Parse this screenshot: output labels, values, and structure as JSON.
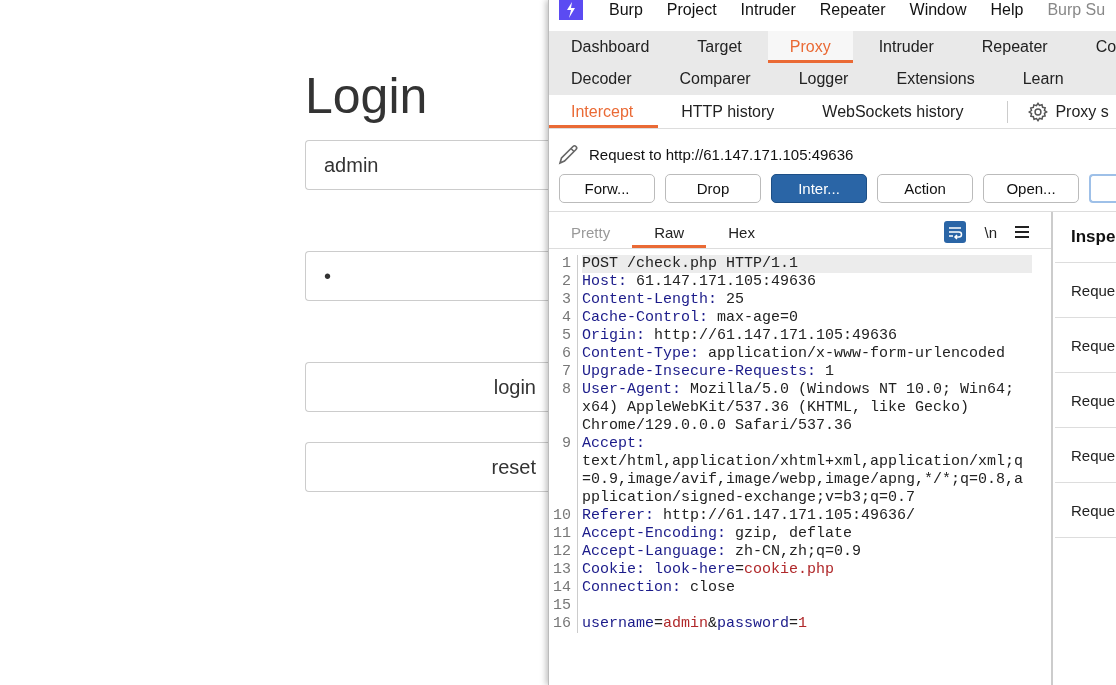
{
  "login_page": {
    "title": "Login",
    "username": {
      "value": "admin"
    },
    "password": {
      "value": "•"
    },
    "buttons": [
      "login",
      "reset"
    ]
  },
  "menu_bar": {
    "items": [
      "Burp",
      "Project",
      "Intruder",
      "Repeater",
      "Window",
      "Help"
    ],
    "app_title": "Burp Su"
  },
  "tool_tabs": [
    [
      {
        "label": "Dashboard",
        "selected": false
      },
      {
        "label": "Target",
        "selected": false
      },
      {
        "label": "Proxy",
        "selected": true
      },
      {
        "label": "Intruder",
        "selected": false
      },
      {
        "label": "Repeater",
        "selected": false
      },
      {
        "label": "Co",
        "selected": false
      }
    ],
    [
      {
        "label": "Decoder",
        "selected": false
      },
      {
        "label": "Comparer",
        "selected": false
      },
      {
        "label": "Logger",
        "selected": false
      },
      {
        "label": "Extensions",
        "selected": false
      },
      {
        "label": "Learn",
        "selected": false
      }
    ]
  ],
  "proxy_tabs": [
    {
      "label": "Intercept",
      "selected": true
    },
    {
      "label": "HTTP history",
      "selected": false
    },
    {
      "label": "WebSockets history",
      "selected": false
    }
  ],
  "proxy_settings": "Proxy s",
  "request_title": "Request to http://61.147.171.105:49636",
  "actions": [
    {
      "label": "Forw...",
      "on": false
    },
    {
      "label": "Drop",
      "on": false
    },
    {
      "label": "Inter...",
      "on": true
    },
    {
      "label": "Action",
      "on": false
    },
    {
      "label": "Open...",
      "on": false
    }
  ],
  "editor": {
    "tabs": [
      {
        "label": "Pretty",
        "selected": false,
        "disabled": true
      },
      {
        "label": "Raw",
        "selected": true,
        "disabled": false
      },
      {
        "label": "Hex",
        "selected": false,
        "disabled": false
      }
    ],
    "wrap_on": true,
    "newline_label": "\\n",
    "lines": [
      {
        "number": "1",
        "highlighted": true,
        "parts": [
          {
            "kind": "plain",
            "text": "POST /check.php HTTP/1.1"
          }
        ]
      },
      {
        "number": "2",
        "highlighted": false,
        "parts": [
          {
            "kind": "name",
            "text": "Host:"
          },
          {
            "kind": "plain",
            "text": " 61.147.171.105:49636"
          }
        ]
      },
      {
        "number": "3",
        "highlighted": false,
        "parts": [
          {
            "kind": "name",
            "text": "Content-Length:"
          },
          {
            "kind": "plain",
            "text": " 25"
          }
        ]
      },
      {
        "number": "4",
        "highlighted": false,
        "parts": [
          {
            "kind": "name",
            "text": "Cache-Control:"
          },
          {
            "kind": "plain",
            "text": " max-age=0"
          }
        ]
      },
      {
        "number": "5",
        "highlighted": false,
        "parts": [
          {
            "kind": "name",
            "text": "Origin:"
          },
          {
            "kind": "plain",
            "text": " http://61.147.171.105:49636"
          }
        ]
      },
      {
        "number": "6",
        "highlighted": false,
        "parts": [
          {
            "kind": "name",
            "text": "Content-Type:"
          },
          {
            "kind": "plain",
            "text": " application/x-www-form-urlencoded"
          }
        ]
      },
      {
        "number": "7",
        "highlighted": false,
        "parts": [
          {
            "kind": "name",
            "text": "Upgrade-Insecure-Requests:"
          },
          {
            "kind": "plain",
            "text": " 1"
          }
        ]
      },
      {
        "number": "8",
        "highlighted": false,
        "parts": [
          {
            "kind": "name",
            "text": "User-Agent:"
          },
          {
            "kind": "plain",
            "text": " Mozilla/5.0 (Windows NT 10.0; Win64; x64) AppleWebKit/537.36 (KHTML, like Gecko) Chrome/129.0.0.0 Safari/537.36"
          }
        ]
      },
      {
        "number": "9",
        "highlighted": false,
        "parts": [
          {
            "kind": "name",
            "text": "Accept:"
          },
          {
            "kind": "plain",
            "text": " text/html,application/xhtml+xml,application/xml;q=0.9,image/avif,image/webp,image/apng,*/*;q=0.8,application/signed-exchange;v=b3;q=0.7"
          }
        ]
      },
      {
        "number": "10",
        "highlighted": false,
        "parts": [
          {
            "kind": "name",
            "text": "Referer:"
          },
          {
            "kind": "plain",
            "text": " http://61.147.171.105:49636/"
          }
        ]
      },
      {
        "number": "11",
        "highlighted": false,
        "parts": [
          {
            "kind": "name",
            "text": "Accept-Encoding:"
          },
          {
            "kind": "plain",
            "text": " gzip, deflate"
          }
        ]
      },
      {
        "number": "12",
        "highlighted": false,
        "parts": [
          {
            "kind": "name",
            "text": "Accept-Language:"
          },
          {
            "kind": "plain",
            "text": " zh-CN,zh;q=0.9"
          }
        ]
      },
      {
        "number": "13",
        "highlighted": false,
        "parts": [
          {
            "kind": "name",
            "text": "Cookie: look-here"
          },
          {
            "kind": "plain",
            "text": "="
          },
          {
            "kind": "value",
            "text": "cookie.php"
          }
        ]
      },
      {
        "number": "14",
        "highlighted": false,
        "parts": [
          {
            "kind": "name",
            "text": "Connection:"
          },
          {
            "kind": "plain",
            "text": " close"
          }
        ]
      },
      {
        "number": "15",
        "highlighted": false
      },
      {
        "number": "16",
        "highlighted": false,
        "parts": [
          {
            "kind": "name",
            "text": "username"
          },
          {
            "kind": "plain",
            "text": "="
          },
          {
            "kind": "value",
            "text": "admin"
          },
          {
            "kind": "plain",
            "text": "&"
          },
          {
            "kind": "name",
            "text": "password"
          },
          {
            "kind": "plain",
            "text": "="
          },
          {
            "kind": "value",
            "text": "1"
          }
        ]
      }
    ]
  },
  "inspector": {
    "title": "Inspe",
    "rows": [
      "Reque",
      "Reque",
      "Reque",
      "Reque",
      "Reque"
    ]
  }
}
